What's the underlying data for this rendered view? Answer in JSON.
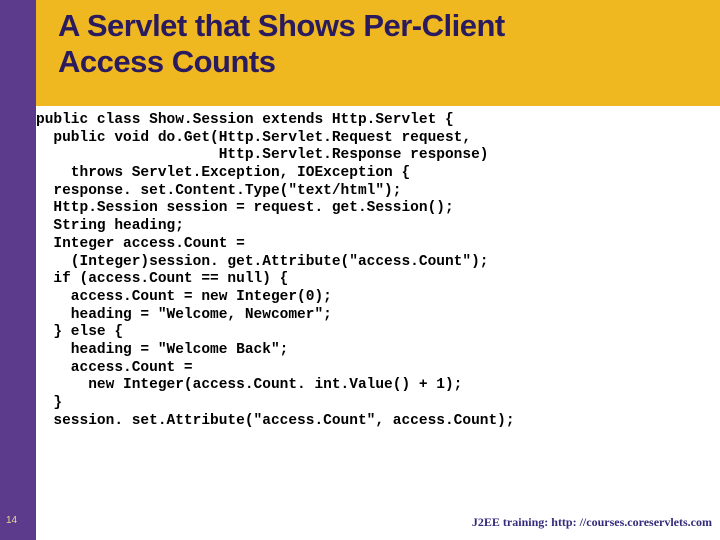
{
  "title_line1": "A Servlet that Shows Per-Client",
  "title_line2": "Access Counts",
  "code": "public class Show.Session extends Http.Servlet {\n  public void do.Get(Http.Servlet.Request request,\n                     Http.Servlet.Response response)\n    throws Servlet.Exception, IOException {\n  response. set.Content.Type(\"text/html\");\n  Http.Session session = request. get.Session();\n  String heading;\n  Integer access.Count =\n    (Integer)session. get.Attribute(\"access.Count\");\n  if (access.Count == null) {\n    access.Count = new Integer(0);\n    heading = \"Welcome, Newcomer\";\n  } else {\n    heading = \"Welcome Back\";\n    access.Count =\n      new Integer(access.Count. int.Value() + 1);\n  }\n  session. set.Attribute(\"access.Count\", access.Count);",
  "page_number": "14",
  "footer_label": "J2EE training: ",
  "footer_url": "http: //courses.coreservlets.com"
}
